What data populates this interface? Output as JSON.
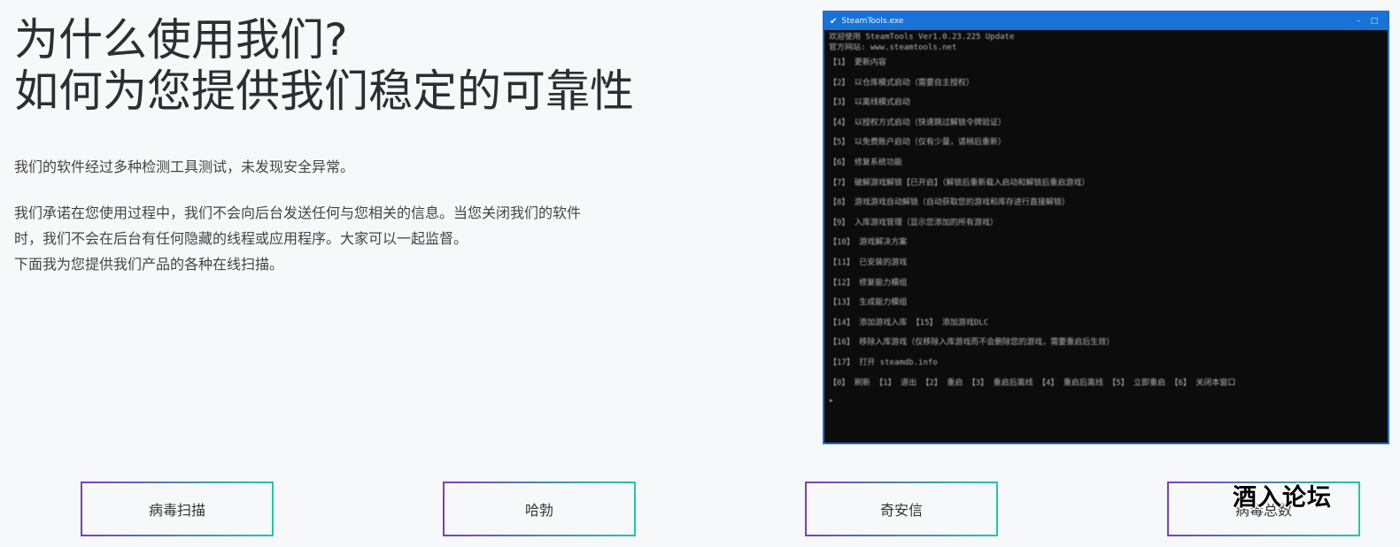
{
  "heading": {
    "line1": "为什么使用我们?",
    "line2": "如何为您提供我们稳定的可靠性"
  },
  "paragraphs": {
    "p1": "我们的软件经过多种检测工具测试，未发现安全异常。",
    "p2_line1": "我们承诺在您使用过程中，我们不会向后台发送任何与您相关的信息。当您关闭我们的软件",
    "p2_line2": "时，我们不会在后台有任何隐藏的线程或应用程序。大家可以一起监督。",
    "p3": "下面我为您提供我们产品的各种在线扫描。"
  },
  "console": {
    "title": "SteamTools.exe",
    "header_lines": [
      "欢迎使用 SteamTools Ver1.0.23.225 Update",
      "官方网站: www.steamtools.net"
    ],
    "menu_lines": [
      "【1】 更新内容",
      "【2】 以仓库模式启动（需要自主授权）",
      "【3】 以离线模式启动",
      "【4】 以授权方式启动（快速跳过解锁令牌验证）",
      "【5】 以免费账户启动（仅有少量，请稍后重新）",
      "【6】 修复系统功能",
      "【7】 破解游戏解锁【已开启】（解锁后重新载入启动和解锁后重启游戏）",
      "【8】 游戏游戏自动解锁（自动获取您的游戏和库存进行直接解锁）",
      "【9】 入库游戏管理（显示您添加的所有游戏）",
      "【10】 游戏解决方案",
      "【11】 已安装的游戏",
      "【12】 修复能力模组",
      "【13】 生成能力模组",
      "【14】 添加游戏入库 【15】 添加游戏DLC",
      "【16】 移除入库游戏（仅移除入库游戏而不会删除您的游戏，需要重启后生效）",
      "【17】 打开 steamdb.info",
      "【0】 刷新 【1】 退出 【2】 重启 【3】 重启后离线 【4】 重启后离线 【5】 立即重启 【6】 关闭本窗口"
    ],
    "prompt": "▸"
  },
  "buttons": {
    "b1": "病毒扫描",
    "b2": "哈勃",
    "b3": "奇安信",
    "b4": "病毒总数"
  },
  "watermark": "酒入论坛"
}
